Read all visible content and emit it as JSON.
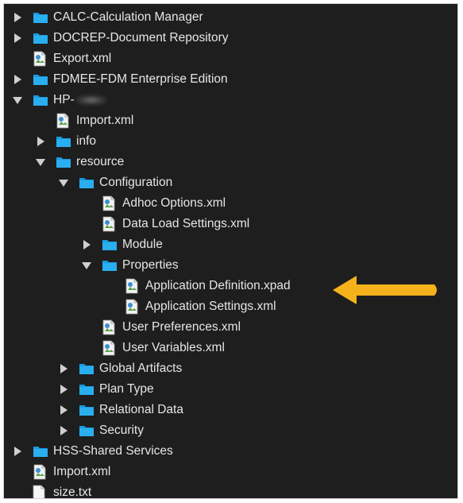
{
  "tree": {
    "calc": "CALC-Calculation Manager",
    "docrep": "DOCREP-Document Repository",
    "export": "Export.xml",
    "fdmee": "FDMEE-FDM Enterprise Edition",
    "hp": "HP-",
    "hp_import": "Import.xml",
    "info": "info",
    "resource": "resource",
    "configuration": "Configuration",
    "adhoc": "Adhoc Options.xml",
    "data_load": "Data Load Settings.xml",
    "module": "Module",
    "properties": "Properties",
    "app_def": "Application Definition.xpad",
    "app_settings": "Application Settings.xml",
    "user_prefs": "User Preferences.xml",
    "user_vars": "User Variables.xml",
    "global_artifacts": "Global Artifacts",
    "plan_type": "Plan Type",
    "relational_data": "Relational Data",
    "security": "Security",
    "hss": "HSS-Shared Services",
    "root_import": "Import.xml",
    "size": "size.txt"
  },
  "colors": {
    "background": "#1e1e1e",
    "text": "#e6e6e6",
    "folder": "#1aa3e8",
    "arrow": "#f5b21b"
  }
}
